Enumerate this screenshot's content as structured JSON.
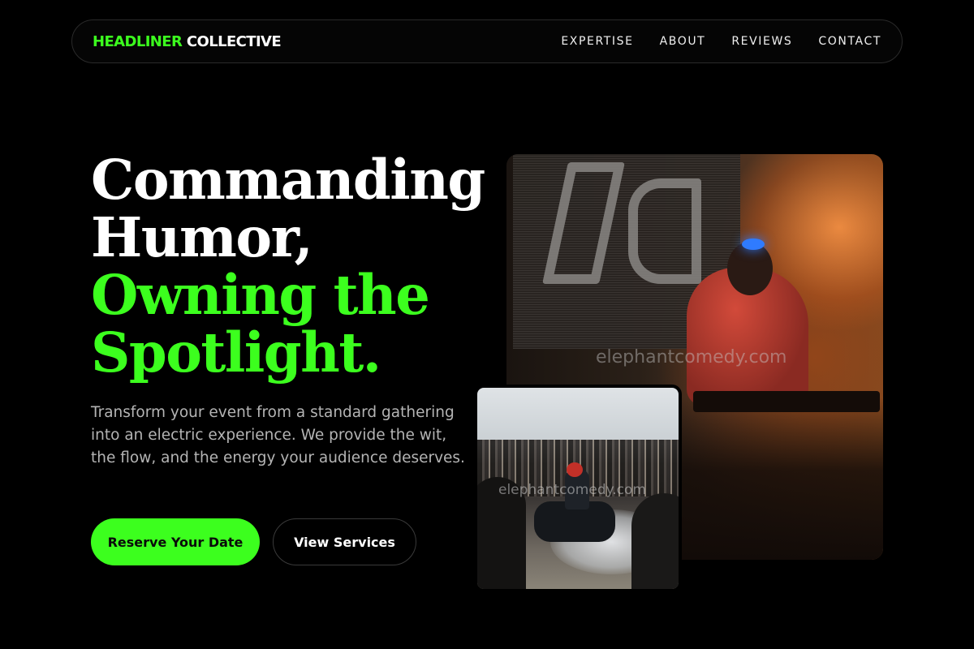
{
  "brand": {
    "accent": "HEADLINER",
    "rest": "COLLECTIVE"
  },
  "nav": {
    "items": [
      {
        "label": "EXPERTISE"
      },
      {
        "label": "ABOUT"
      },
      {
        "label": "REVIEWS"
      },
      {
        "label": "CONTACT"
      }
    ]
  },
  "hero": {
    "headline": {
      "line1": "Commanding",
      "line2": "Humor,",
      "line3": "Owning the",
      "line4": "Spotlight."
    },
    "lead": "Transform your event from a standard gathering into an electric experience. We provide the wit, the flow, and the energy your audience deserves.",
    "primary_cta": "Reserve Your Date",
    "secondary_cta": "View Services"
  },
  "images": {
    "main_watermark": "elephantcomedy.com",
    "inset_watermark": "elephantcomedy.com"
  },
  "colors": {
    "accent": "#3cff1e",
    "background": "#000000",
    "text_muted": "#b4b4b4"
  }
}
